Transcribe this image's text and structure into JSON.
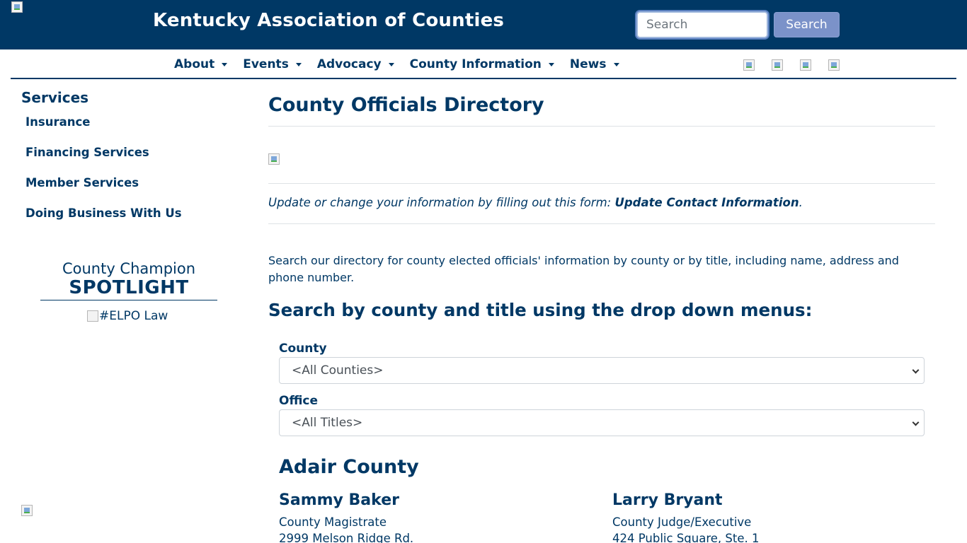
{
  "header": {
    "site_title": "Kentucky Association of Counties",
    "search_placeholder": "Search",
    "search_button": "Search"
  },
  "nav": {
    "items": [
      {
        "label": "About"
      },
      {
        "label": "Events"
      },
      {
        "label": "Advocacy"
      },
      {
        "label": "County Information"
      },
      {
        "label": "News"
      }
    ]
  },
  "sidebar": {
    "title": "Services",
    "links": [
      {
        "label": "Insurance"
      },
      {
        "label": "Financing Services"
      },
      {
        "label": "Member Services"
      },
      {
        "label": "Doing Business With Us"
      }
    ],
    "champion_top": "County Champion",
    "champion_spotlight": "SPOTLIGHT",
    "champion_image_alt": "#ELPO Law"
  },
  "main": {
    "title": "County Officials Directory",
    "update_prefix": "Update or change your information by filling out this form: ",
    "update_link": "Update Contact Information",
    "update_suffix": ".",
    "intro": "Search our directory for county elected officials' information by county or by title, including name, address and phone number.",
    "search_heading": "Search by county and title using the drop down menus:",
    "county_label": "County",
    "county_selected": "<All Counties>",
    "office_label": "Office",
    "office_selected": "<All Titles>",
    "county_heading": "Adair County",
    "officials": [
      {
        "name": "Sammy Baker",
        "title": "County Magistrate",
        "address": "2999 Melson Ridge Rd."
      },
      {
        "name": "Larry Bryant",
        "title": "County Judge/Executive",
        "address": "424 Public Square, Ste. 1"
      }
    ]
  }
}
